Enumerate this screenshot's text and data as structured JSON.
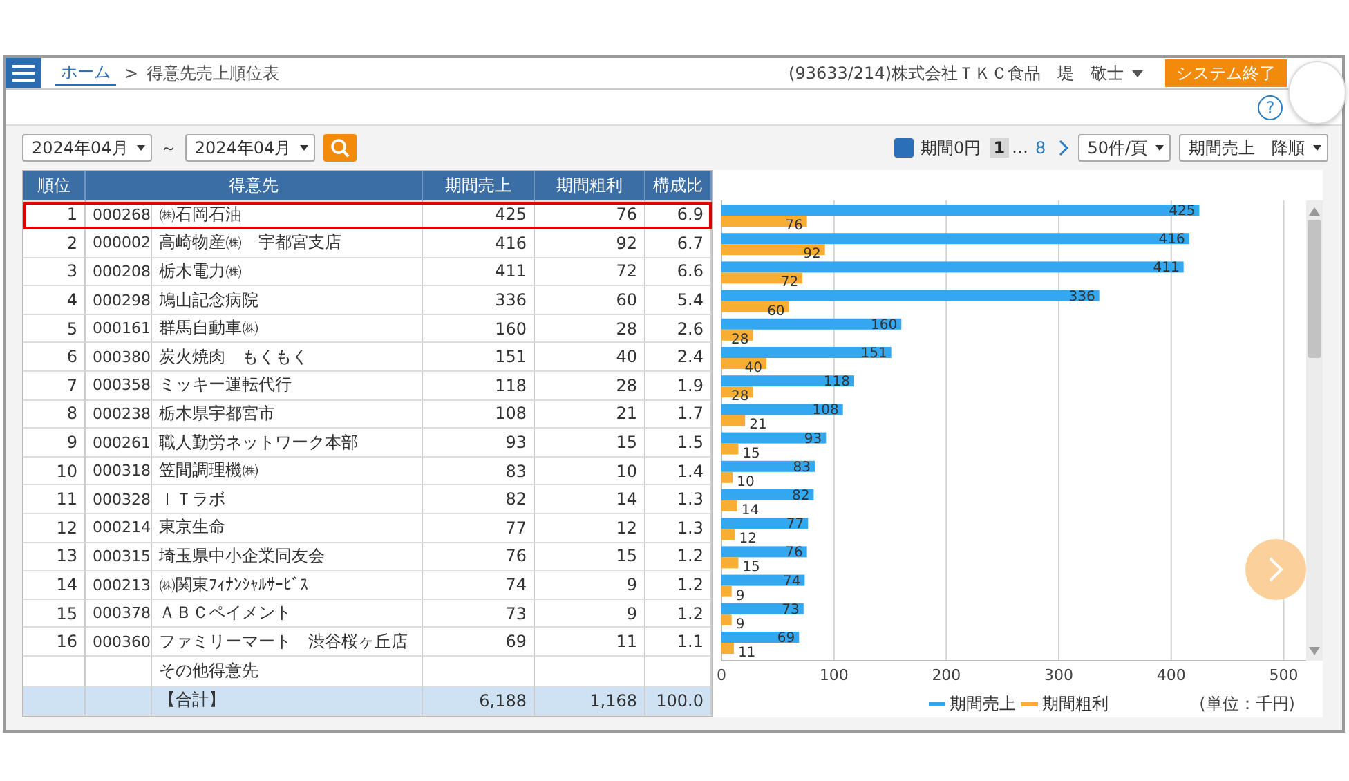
{
  "header": {
    "home_link": "ホーム",
    "separator": ">",
    "page_title": "得意先売上順位表",
    "user": "(93633/214)株式会社ＴＫＣ食品　堤　敬士",
    "exit_button": "システム終了",
    "help": "?"
  },
  "filters": {
    "from": "2024年04月",
    "range_mark": "～",
    "to": "2024年04月",
    "zero_period": {
      "label": "期間0円",
      "checked": true
    },
    "pager": {
      "pages": [
        {
          "label": "1",
          "selected": true
        },
        {
          "label": "8",
          "selected": false
        }
      ],
      "gap": "…"
    },
    "page_size": "50件/頁",
    "sort": "期間売上　降順"
  },
  "table": {
    "columns": [
      "順位",
      "得意先",
      "期間売上",
      "期間粗利",
      "構成比"
    ],
    "rows": [
      {
        "rank": "1",
        "code": "000268",
        "name": "㈱石岡石油",
        "sales": "425",
        "profit": "76",
        "ratio": "6.9",
        "selected": true
      },
      {
        "rank": "2",
        "code": "000002",
        "name": "高崎物産㈱　宇都宮支店",
        "sales": "416",
        "profit": "92",
        "ratio": "6.7",
        "selected": false
      },
      {
        "rank": "3",
        "code": "000208",
        "name": "栃木電力㈱",
        "sales": "411",
        "profit": "72",
        "ratio": "6.6",
        "selected": false
      },
      {
        "rank": "4",
        "code": "000298",
        "name": "鳩山記念病院",
        "sales": "336",
        "profit": "60",
        "ratio": "5.4",
        "selected": false
      },
      {
        "rank": "5",
        "code": "000161",
        "name": "群馬自動車㈱",
        "sales": "160",
        "profit": "28",
        "ratio": "2.6",
        "selected": false
      },
      {
        "rank": "6",
        "code": "000380",
        "name": "炭火焼肉　もくもく",
        "sales": "151",
        "profit": "40",
        "ratio": "2.4",
        "selected": false
      },
      {
        "rank": "7",
        "code": "000358",
        "name": "ミッキー運転代行",
        "sales": "118",
        "profit": "28",
        "ratio": "1.9",
        "selected": false
      },
      {
        "rank": "8",
        "code": "000238",
        "name": "栃木県宇都宮市",
        "sales": "108",
        "profit": "21",
        "ratio": "1.7",
        "selected": false
      },
      {
        "rank": "9",
        "code": "000261",
        "name": "職人勤労ネットワーク本部",
        "sales": "93",
        "profit": "15",
        "ratio": "1.5",
        "selected": false
      },
      {
        "rank": "10",
        "code": "000318",
        "name": "笠間調理機㈱",
        "sales": "83",
        "profit": "10",
        "ratio": "1.4",
        "selected": false
      },
      {
        "rank": "11",
        "code": "000328",
        "name": "ＩＴラボ",
        "sales": "82",
        "profit": "14",
        "ratio": "1.3",
        "selected": false
      },
      {
        "rank": "12",
        "code": "000214",
        "name": "東京生命",
        "sales": "77",
        "profit": "12",
        "ratio": "1.3",
        "selected": false
      },
      {
        "rank": "13",
        "code": "000315",
        "name": "埼玉県中小企業同友会",
        "sales": "76",
        "profit": "15",
        "ratio": "1.2",
        "selected": false
      },
      {
        "rank": "14",
        "code": "000213",
        "name": "㈱関東ﾌｨﾅﾝｼｬﾙｻｰﾋﾞｽ",
        "sales": "74",
        "profit": "9",
        "ratio": "1.2",
        "selected": false
      },
      {
        "rank": "15",
        "code": "000378",
        "name": "ＡＢＣペイメント",
        "sales": "73",
        "profit": "9",
        "ratio": "1.2",
        "selected": false
      },
      {
        "rank": "16",
        "code": "000360",
        "name": "ファミリーマート　渋谷桜ヶ丘店",
        "sales": "69",
        "profit": "11",
        "ratio": "1.1",
        "selected": false
      }
    ],
    "other_row": {
      "name": "その他得意先"
    },
    "total_row": {
      "name": "【合計】",
      "sales": "6,188",
      "profit": "1,168",
      "ratio": "100.0"
    }
  },
  "chart": {
    "unit": "(単位：千円)",
    "chart_data": {
      "type": "bar",
      "orientation": "horizontal",
      "grid": true,
      "value_labels": [
        [
          "425",
          "416",
          "411",
          "336",
          "160",
          "151",
          "118",
          "108",
          "93",
          "83",
          "82",
          "77",
          "76",
          "74",
          "73",
          "69"
        ],
        [
          "76",
          "92",
          "72",
          "60",
          "28",
          "40",
          "28",
          "21",
          "15",
          "10",
          "14",
          "12",
          "15",
          "9",
          "9",
          "11"
        ]
      ],
      "xlim": [
        0,
        520
      ],
      "xticks": [
        0,
        100,
        200,
        300,
        400,
        500
      ],
      "series": [
        {
          "name": "期間売上",
          "color": "#33a8f0",
          "values": [
            425,
            416,
            411,
            336,
            160,
            151,
            118,
            108,
            93,
            83,
            82,
            77,
            76,
            74,
            73,
            69
          ]
        },
        {
          "name": "期間粗利",
          "color": "#f7ae32",
          "values": [
            76,
            92,
            72,
            60,
            28,
            40,
            28,
            21,
            15,
            10,
            14,
            12,
            15,
            9,
            9,
            11
          ]
        }
      ]
    }
  }
}
